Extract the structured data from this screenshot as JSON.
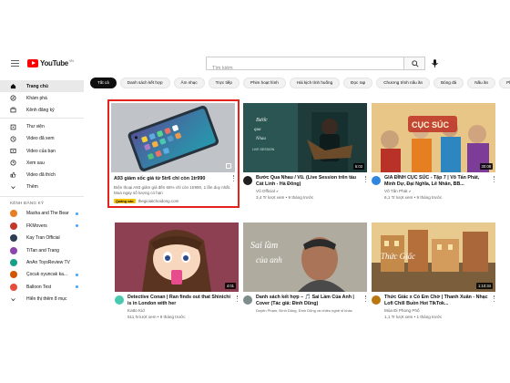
{
  "masthead": {
    "logo_text": "YouTube",
    "logo_sup": "VN",
    "search_placeholder": "Tìm kiếm"
  },
  "sidebar": {
    "items": [
      {
        "label": "Trang chủ",
        "icon": "home-icon",
        "active": true
      },
      {
        "label": "Khám phá",
        "icon": "compass-icon"
      },
      {
        "label": "Kênh đăng ký",
        "icon": "subscriptions-icon"
      },
      {
        "label": "Thư viện",
        "icon": "library-icon"
      },
      {
        "label": "Video đã xem",
        "icon": "history-icon"
      },
      {
        "label": "Video của bạn",
        "icon": "your-videos-icon"
      },
      {
        "label": "Xem sau",
        "icon": "clock-icon"
      },
      {
        "label": "Video đã thích",
        "icon": "like-icon"
      },
      {
        "label": "Thêm",
        "icon": "chevron-down-icon"
      }
    ],
    "subscriptions_heading": "KÊNH ĐĂNG KÝ",
    "subscriptions": [
      {
        "label": "Masha and The Bear",
        "color": "#e67e22",
        "dot": true
      },
      {
        "label": "FKMovers",
        "color": "#c0392b",
        "dot": true
      },
      {
        "label": "Kay Tran Official",
        "color": "#2c3e50",
        "dot": false
      },
      {
        "label": "TiTan and Trang",
        "color": "#8e44ad",
        "dot": false
      },
      {
        "label": "AnAn ToysReview TV",
        "color": "#16a085",
        "dot": false
      },
      {
        "label": "Çocuk oyuncak ka...",
        "color": "#d35400",
        "dot": true
      },
      {
        "label": "Balloon Test",
        "color": "#e74c3c",
        "dot": true
      }
    ],
    "more_channels": "Hiển thị thêm 8 mục"
  },
  "chips": [
    "Tất cả",
    "Danh sách kết hợp",
    "Âm nhạc",
    "Trực tiếp",
    "Phim hoạt hình",
    "Hài kịch tình huống",
    "Đọc rap",
    "Chương trình nấu ăn",
    "Bóng đá",
    "Nấu ăn",
    "Ph"
  ],
  "ad": {
    "title": "A93 giảm sốc giá từ 5tr6 chỉ còn 1tr990",
    "description": "Điện thoại A93 giảm giá đến 65% chỉ còn 1tr990, 1 lần duy nhất. Mua ngay số lượng có hạn",
    "badge": "Quảng cáo",
    "domain": "thegioialchoidong.com"
  },
  "videos": [
    {
      "title": "Bước Qua Nhau / Vũ. (Live Session trên tàu Cát Linh - Hà Đông)",
      "channel": "Vũ Official",
      "verified": true,
      "meta": "3,4 Tr lượt xem • 9 tháng trước",
      "duration": "5:03",
      "avatar_color": "#1f1f1f"
    },
    {
      "title": "GIA ĐÌNH CỤC SÚC - Tập 7 | Võ Tấn Phát, Minh Dự, Đại Nghĩa, Lê Nhân, BB...",
      "channel": "Võ Tấn Phát",
      "verified": true,
      "meta": "6,1 Tr lượt xem • 9 tháng trước",
      "duration": "30:08",
      "avatar_color": "#2e86de"
    },
    {
      "title": "Detective Conan | Ran finds out that Shinichi is in London with her",
      "channel": "Katto Kid",
      "verified": false,
      "meta": "511 N lượt xem • 9 tháng trước",
      "duration": "4:01",
      "avatar_color": "#48c9b0"
    },
    {
      "title": "Danh sách kết hợp – 🎵 Sai Lầm Của Anh | Cover (Tác giả: Đình Dũng)",
      "channel": "Duyên Phạm, Đình Dũng, Đình Dũng và nhiều nghệ sĩ khác",
      "verified": false,
      "meta": "",
      "duration": "",
      "avatar_color": "#7f8c8d"
    },
    {
      "title": "Thức Giấc x Có Em Chờ | Thanh Xuân - Nhạc Lofi Chill Buồn Hot TikTok...",
      "channel": "Mùa Đi Phong Phố",
      "verified": false,
      "meta": "1,1 Tr lượt xem • 1 tháng trước",
      "duration": "1:10:34",
      "avatar_color": "#b9770e"
    }
  ]
}
